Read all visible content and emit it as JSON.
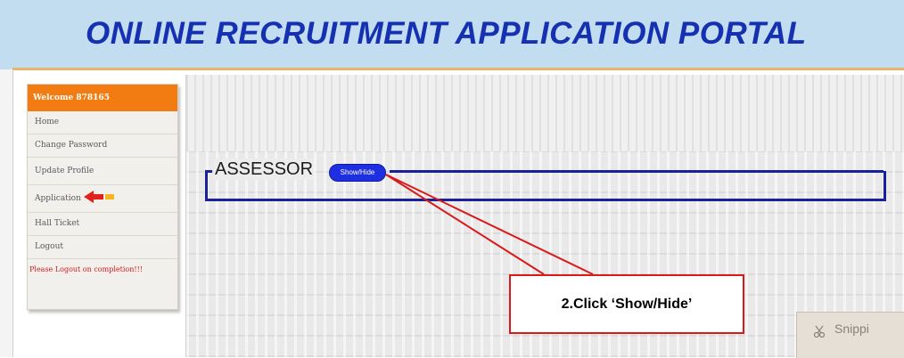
{
  "header": {
    "title": "ONLINE RECRUITMENT APPLICATION PORTAL"
  },
  "sidebar": {
    "welcome": "Welcome 878165",
    "items": [
      {
        "label": "Home"
      },
      {
        "label": "Change Password"
      },
      {
        "label": "Update Profile"
      },
      {
        "label": "Application"
      },
      {
        "label": "Hall Ticket"
      },
      {
        "label": "Logout"
      }
    ],
    "logout_note": "Please Logout on completion!!!"
  },
  "section": {
    "legend": "ASSESSOR",
    "toggle_label": "Show/Hide"
  },
  "callout": {
    "text": "2.Click ‘Show/Hide’"
  },
  "snipping": {
    "label": "Snippi"
  },
  "colors": {
    "header_bg": "#c2ddef",
    "title": "#1630b2",
    "welcome_bg": "#f27b12",
    "fieldset_border": "#1a1f9c",
    "toggle_bg": "#1d2fe0",
    "callout_red": "#d91a1a"
  }
}
